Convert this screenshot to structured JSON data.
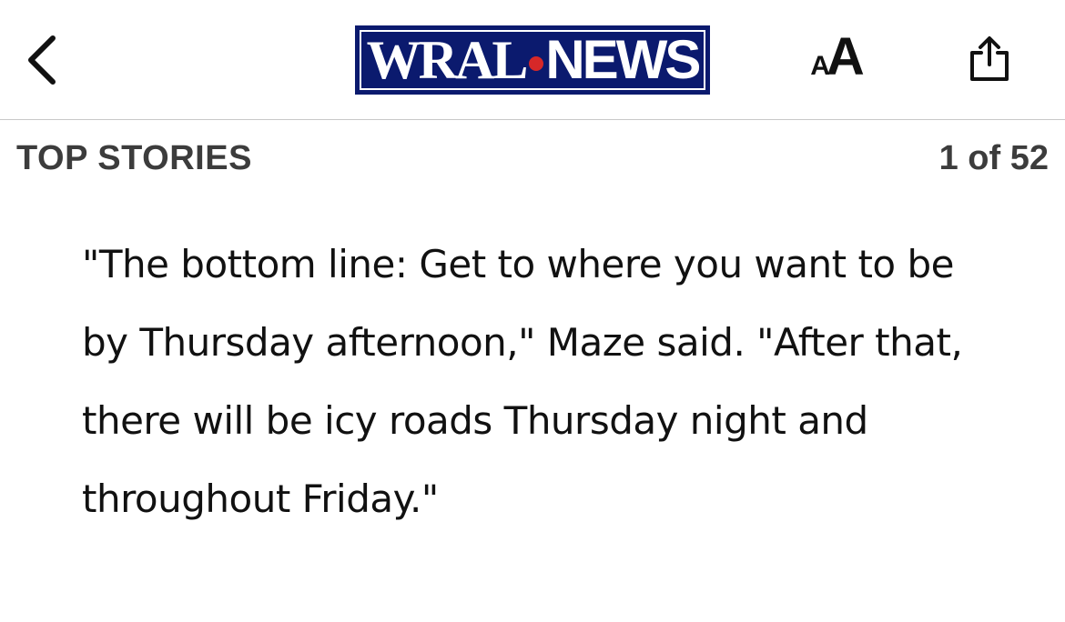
{
  "navbar": {
    "back_icon": "chevron-left-icon",
    "logo": {
      "left_text": "WRAL",
      "right_text": "NEWS",
      "background_color": "#0b1a6e",
      "dot_color": "#d62828"
    },
    "text_size_button": {
      "small_glyph": "A",
      "large_glyph": "A"
    },
    "share_icon": "share-icon"
  },
  "section": {
    "title": "TOP STORIES",
    "counter": "1 of 52"
  },
  "article": {
    "paragraph": "\"The bottom line: Get to where you want to be by Thursday afternoon,\" Maze said. \"After that, there will be icy roads Thursday night and throughout Friday.\""
  }
}
